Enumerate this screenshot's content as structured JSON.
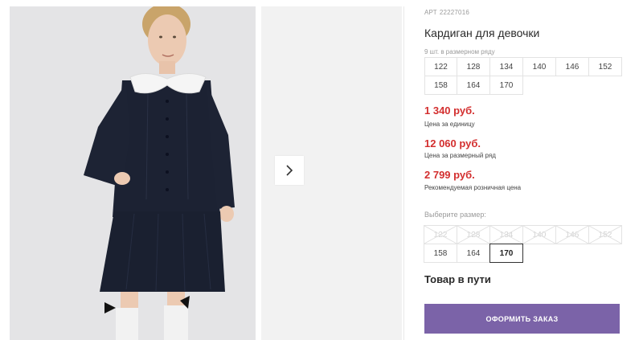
{
  "product": {
    "article_label": "АРТ",
    "article": "22227016",
    "title": "Кардиган для девочки",
    "pack_note": "9 шт. в размерном ряду",
    "size_row": [
      "122",
      "128",
      "134",
      "140",
      "146",
      "152",
      "158",
      "164",
      "170"
    ],
    "prices": [
      {
        "value": "1 340 руб.",
        "note": "Цена за единицу"
      },
      {
        "value": "12 060 руб.",
        "note": "Цена за размерный ряд"
      },
      {
        "value": "2 799 руб.",
        "note": "Рекомендуемая розничная цена"
      }
    ],
    "choose_label": "Выберите размер:",
    "select_sizes": [
      {
        "label": "122",
        "available": false
      },
      {
        "label": "128",
        "available": false
      },
      {
        "label": "134",
        "available": false
      },
      {
        "label": "140",
        "available": false
      },
      {
        "label": "146",
        "available": false
      },
      {
        "label": "152",
        "available": false
      },
      {
        "label": "158",
        "available": true
      },
      {
        "label": "164",
        "available": true
      },
      {
        "label": "170",
        "available": true,
        "selected": true
      }
    ],
    "status": "Товар в пути",
    "order_button": "ОФОРМИТЬ ЗАКАЗ"
  },
  "colors": {
    "price": "#d32f2f",
    "button": "#7b63a8"
  },
  "icons": {
    "next": "chevron-right-icon"
  }
}
